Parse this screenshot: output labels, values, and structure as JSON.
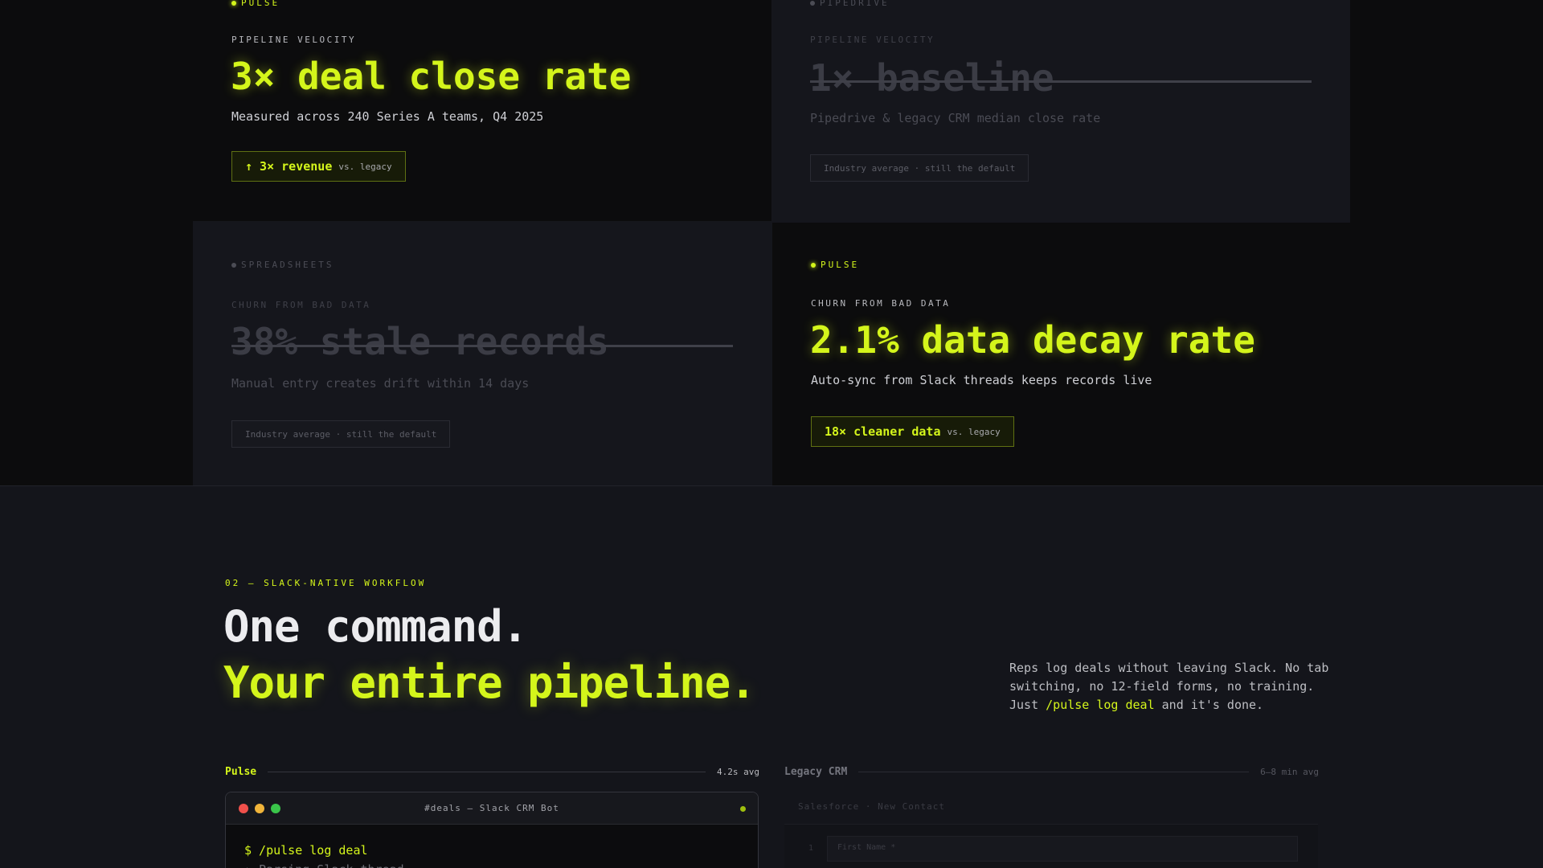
{
  "comparison": {
    "pulse_velocity": {
      "tag": "PULSE",
      "label": "PIPELINE VELOCITY",
      "headline": "3× deal close rate",
      "subtext": "Measured across 240 Series A teams, Q4 2025",
      "chip_strong": "↑ 3× revenue",
      "chip_muted": "vs. legacy"
    },
    "legacy_velocity": {
      "tag": "PIPEDRIVE",
      "label": "PIPELINE VELOCITY",
      "headline": "1× baseline",
      "subtext": "Pipedrive & legacy CRM median close rate",
      "chip": "Industry average · still the default"
    },
    "legacy_churn": {
      "tag": "SPREADSHEETS",
      "label": "CHURN FROM BAD DATA",
      "headline": "38% stale records",
      "subtext": "Manual entry creates drift within 14 days",
      "chip": "Industry average · still the default"
    },
    "pulse_churn": {
      "tag": "PULSE",
      "label": "CHURN FROM BAD DATA",
      "headline": "2.1% data decay rate",
      "subtext": "Auto-sync from Slack threads keeps records live",
      "chip_strong": "18× cleaner data",
      "chip_muted": "vs. legacy"
    }
  },
  "workflow": {
    "eyebrow": "02 — SLACK-NATIVE WORKFLOW",
    "title_line1": "One command.",
    "title_line2": "Your entire pipeline.",
    "description_before": "Reps log deals without leaving Slack. No tab switching, no 12-field forms, no training. Just ",
    "description_command": "/pulse log deal",
    "description_after": " and it's done.",
    "pulse_panel": {
      "name": "Pulse",
      "meta": "4.2s avg",
      "window_title": "#deals — Slack CRM Bot",
      "line1": "$ /pulse log deal",
      "line2": "› Parsing Slack thread..."
    },
    "legacy_panel": {
      "name": "Legacy CRM",
      "meta": "6–8 min avg",
      "form_title": "Salesforce · New Contact",
      "field_number": "1",
      "field_placeholder": "First Name *"
    }
  },
  "colors": {
    "accent": "#d4f51b",
    "background": "#14151b",
    "panel_dark": "#0c0c0d"
  }
}
